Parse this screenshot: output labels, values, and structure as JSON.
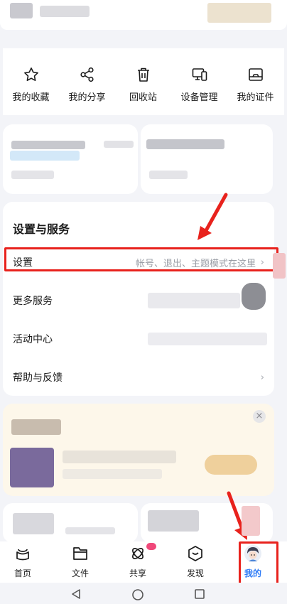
{
  "quick_actions": [
    {
      "label": "我的收藏",
      "icon": "star-icon"
    },
    {
      "label": "我的分享",
      "icon": "share-icon"
    },
    {
      "label": "回收站",
      "icon": "trash-icon"
    },
    {
      "label": "设备管理",
      "icon": "devices-icon"
    },
    {
      "label": "我的证件",
      "icon": "id-card-icon"
    }
  ],
  "settings_section": {
    "title": "设置与服务",
    "rows": [
      {
        "label": "设置",
        "hint": "帐号、退出、主题模式在这里",
        "chevron": "›"
      },
      {
        "label": "更多服务"
      },
      {
        "label": "活动中心"
      },
      {
        "label": "帮助与反馈",
        "chevron": "›"
      }
    ]
  },
  "banner": {
    "close_symbol": "×"
  },
  "bottom_nav": {
    "items": [
      {
        "label": "首页",
        "icon": "home-icon"
      },
      {
        "label": "文件",
        "icon": "folder-icon"
      },
      {
        "label": "共享",
        "icon": "share-orbit-icon"
      },
      {
        "label": "发现",
        "icon": "discover-icon"
      },
      {
        "label": "我的",
        "icon": "avatar-icon",
        "active": true
      }
    ]
  },
  "colors": {
    "accent": "#2f7cf6",
    "annotation_red": "#e8221d",
    "background": "#f3f4f8"
  }
}
